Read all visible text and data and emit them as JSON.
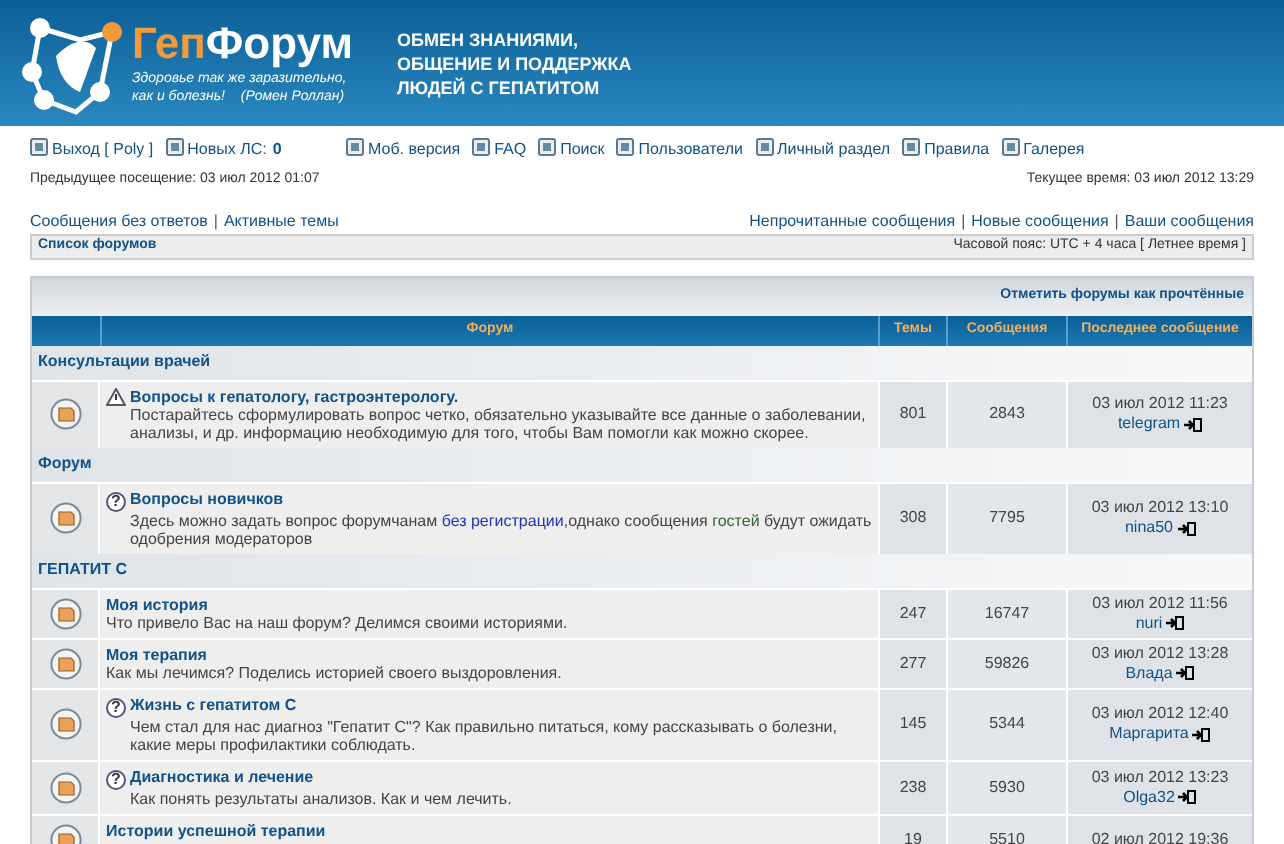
{
  "header": {
    "logo_a": "Геп",
    "logo_b": "Форум",
    "slogan_1": "Здоровье так же заразительно,",
    "slogan_2": "как и болезнь!",
    "slogan_author": "(Ромен Роллан)",
    "tagline": [
      "ОБМЕН ЗНАНИЯМИ,",
      "ОБЩЕНИЕ И ПОДДЕРЖКА",
      "ЛЮДЕЙ С ГЕПАТИТОМ"
    ]
  },
  "nav_left": [
    {
      "label": "Выход [ Poly ]"
    },
    {
      "label": "Новых ЛС:",
      "count": "0"
    }
  ],
  "nav_right": [
    {
      "label": "Моб. версия"
    },
    {
      "label": "FAQ"
    },
    {
      "label": "Поиск"
    },
    {
      "label": "Пользователи"
    },
    {
      "label": "Личный раздел"
    },
    {
      "label": "Правила"
    },
    {
      "label": "Галерея"
    }
  ],
  "last_visit": "Предыдущее посещение: 03 июл 2012 01:07",
  "current_time": "Текущее время: 03 июл 2012 13:29",
  "link_separator": "|",
  "links_left": [
    "Сообщения без ответов",
    "Активные темы"
  ],
  "links_right": [
    "Непрочитанные сообщения",
    "Новые сообщения",
    "Ваши сообщения"
  ],
  "breadcrumb": "Список форумов",
  "timezone": "Часовой пояс: UTC + 4 часа [ Летнее время ]",
  "mark_read": "Отметить форумы как прочтённые",
  "table": {
    "columns": [
      "Форум",
      "Темы",
      "Сообщения",
      "Последнее сообщение"
    ],
    "categories": [
      {
        "name": "Консультации врачей",
        "forums": [
          {
            "title": "Вопросы к гепатологу, гастроэнтерологу.",
            "kind": "warning",
            "description": [
              {
                "kind": "text",
                "text": "Постарайтесь сформулировать вопрос четко, обязательно указывайте все данные о заболевании, анализы, и др. информацию необходимую для того, чтобы Вам помогли как можно скорее."
              }
            ],
            "topics": "801",
            "posts": "2843",
            "last_date": "03 июл 2012 11:23",
            "last_user": "telegram"
          }
        ]
      },
      {
        "name": "Форум",
        "forums": [
          {
            "title": "Вопросы новичков",
            "kind": "question",
            "icon_text": "?",
            "description": [
              {
                "kind": "text",
                "text": "Здесь можно задать вопрос форумчанам "
              },
              {
                "kind": "link",
                "text": "без регистрации"
              },
              {
                "kind": "text",
                "text": ",однако сообщения "
              },
              {
                "kind": "guest",
                "text": "гостей"
              },
              {
                "kind": "text",
                "text": " будут ожидать одобрения модераторов"
              }
            ],
            "topics": "308",
            "posts": "7795",
            "last_date": "03 июл 2012 13:10",
            "last_user": "nina50"
          }
        ]
      },
      {
        "name": "ГЕПАТИТ С",
        "forums": [
          {
            "title": "Моя история",
            "kind": "plain",
            "description": [
              {
                "kind": "text",
                "text": "Что привело Вас на наш форум? Делимся своими историями."
              }
            ],
            "topics": "247",
            "posts": "16747",
            "last_date": "03 июл 2012 11:56",
            "last_user": "nuri"
          },
          {
            "title": "Моя терапия",
            "kind": "plain",
            "description": [
              {
                "kind": "text",
                "text": "Как мы лечимся? Поделись историей своего выздоровления."
              }
            ],
            "topics": "277",
            "posts": "59826",
            "last_date": "03 июл 2012 13:28",
            "last_user": "Влада"
          },
          {
            "title": "Жизнь с гепатитом С",
            "kind": "question",
            "icon_text": "?",
            "description": [
              {
                "kind": "text",
                "text": "Чем стал для нас диагноз \"Гепатит С\"? Как правильно питаться, кому рассказывать о болезни, какие меры профилактики соблюдать."
              }
            ],
            "topics": "145",
            "posts": "5344",
            "last_date": "03 июл 2012 12:40",
            "last_user": "Маргарита"
          },
          {
            "title": "Диагностика и лечение",
            "kind": "question",
            "icon_text": "?",
            "description": [
              {
                "kind": "text",
                "text": "Как понять результаты анализов. Как и чем лечить."
              }
            ],
            "topics": "238",
            "posts": "5930",
            "last_date": "03 июл 2012 13:23",
            "last_user": "Olga32"
          },
          {
            "title": "Истории успешной терапии",
            "kind": "plain",
            "topics": "19",
            "posts": "5510",
            "last_date": "02 июл 2012 19:36"
          }
        ]
      }
    ]
  }
}
